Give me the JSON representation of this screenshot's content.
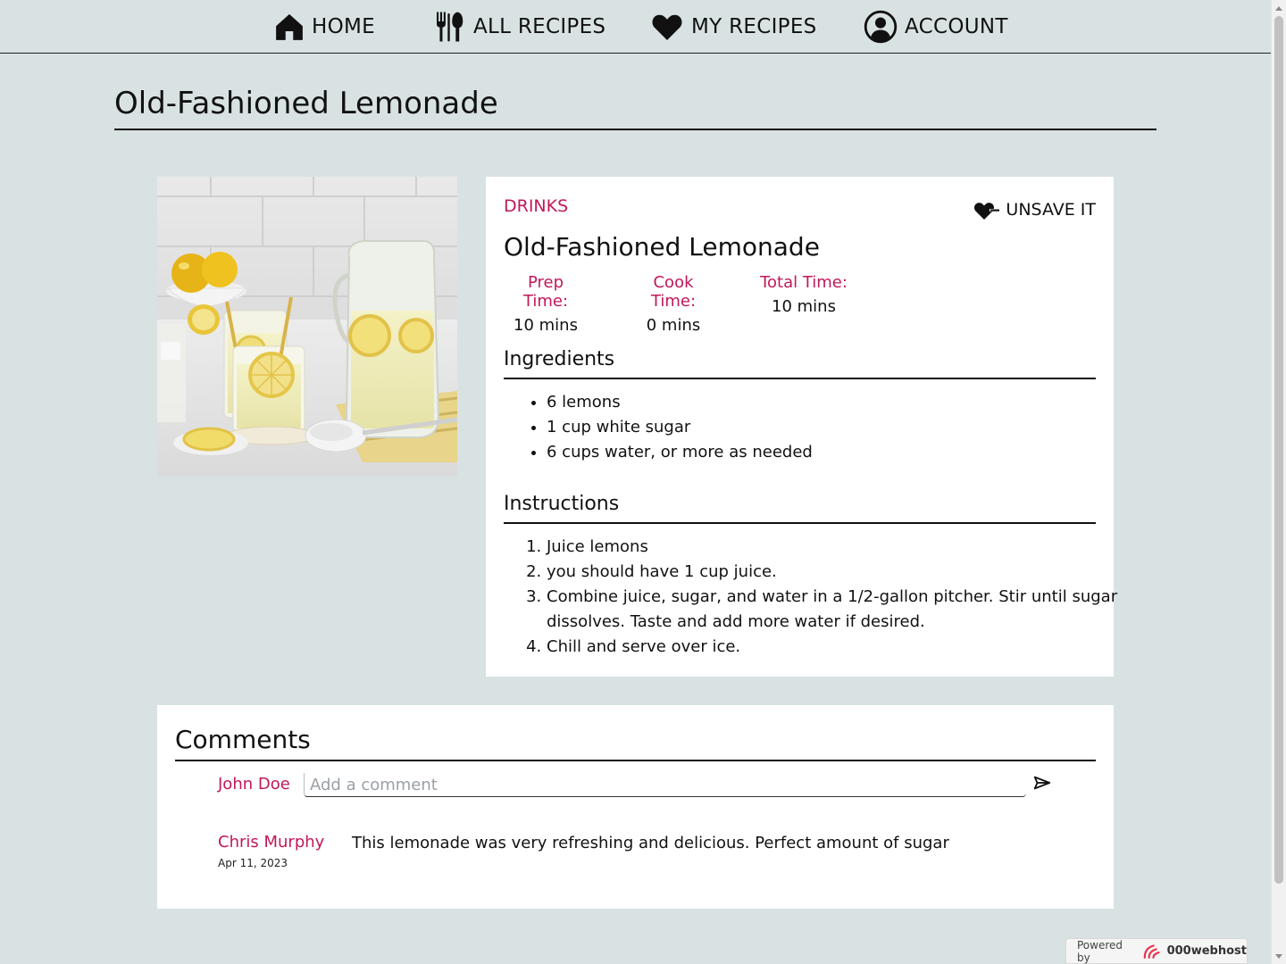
{
  "nav": {
    "items": [
      {
        "label": "HOME",
        "icon": "home-icon"
      },
      {
        "label": "ALL RECIPES",
        "icon": "fork-knife-icon"
      },
      {
        "label": "MY RECIPES",
        "icon": "heart-icon"
      },
      {
        "label": "ACCOUNT",
        "icon": "user-circle-icon"
      }
    ]
  },
  "page": {
    "title": "Old-Fashioned Lemonade"
  },
  "recipe": {
    "category": "DRINKS",
    "unsave_label": "UNSAVE IT",
    "name": "Old-Fashioned Lemonade",
    "times": [
      {
        "label": "Prep Time:",
        "value": "10 mins"
      },
      {
        "label": "Cook Time:",
        "value": "0 mins"
      },
      {
        "label": "Total Time:",
        "value": "10 mins"
      }
    ],
    "ingredients_title": "Ingredients",
    "ingredients": [
      "6 lemons",
      "1 cup white sugar",
      "6 cups water, or more as needed"
    ],
    "instructions_title": "Instructions",
    "instructions": [
      "Juice lemons",
      "you should have 1 cup juice.",
      "Combine juice, sugar, and water in a 1/2-gallon pitcher. Stir until sugar dissolves. Taste and add more water if desired.",
      "Chill and serve over ice."
    ]
  },
  "comments": {
    "title": "Comments",
    "current_user": "John Doe",
    "input_placeholder": "Add a comment",
    "list": [
      {
        "author": "Chris Murphy",
        "date": "Apr 11, 2023",
        "text": "This lemonade was very refreshing and delicious. Perfect amount of sugar"
      }
    ]
  },
  "footer": {
    "powered_by": "Powered by",
    "brand": "000webhost"
  },
  "colors": {
    "accent": "#c2185b",
    "background": "#d9e2e2",
    "card": "#ffffff"
  }
}
